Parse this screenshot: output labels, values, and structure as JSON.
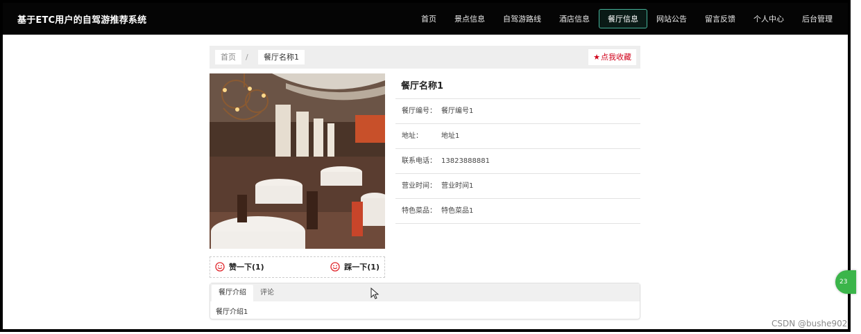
{
  "app": {
    "title": "基于ETC用户的自驾游推荐系统"
  },
  "nav": {
    "items": [
      {
        "label": "首页"
      },
      {
        "label": "景点信息"
      },
      {
        "label": "自驾游路线"
      },
      {
        "label": "酒店信息"
      },
      {
        "label": "餐厅信息",
        "active": true
      },
      {
        "label": "网站公告"
      },
      {
        "label": "留言反馈"
      },
      {
        "label": "个人中心"
      },
      {
        "label": "后台管理"
      }
    ],
    "active_color": "#46b39a"
  },
  "breadcrumb": {
    "home": "首页",
    "separator": "/",
    "current": "餐厅名称1"
  },
  "favorite": {
    "icon": "star-icon",
    "label": "点我收藏",
    "color": "#d0021b"
  },
  "restaurant": {
    "name": "餐厅名称1",
    "photo": "restaurant-interior-photo",
    "fields": [
      {
        "label": "餐厅编号：",
        "value": "餐厅编号1"
      },
      {
        "label": "地址：",
        "value": "地址1"
      },
      {
        "label": "联系电话：",
        "value": "13823888881"
      },
      {
        "label": "营业时间：",
        "value": "营业时间1"
      },
      {
        "label": "特色菜品：",
        "value": "特色菜品1"
      }
    ]
  },
  "votes": {
    "up_label": "赞一下(1)",
    "down_label": "踩一下(1)",
    "icon": "smiley-icon",
    "icon_color": "#e0252a"
  },
  "tabs": {
    "items": [
      {
        "label": "餐厅介绍",
        "active": true
      },
      {
        "label": "评论"
      }
    ],
    "content": "餐厅介绍1"
  },
  "float_badge": {
    "label": "23"
  },
  "watermark": "CSDN @bushe902"
}
